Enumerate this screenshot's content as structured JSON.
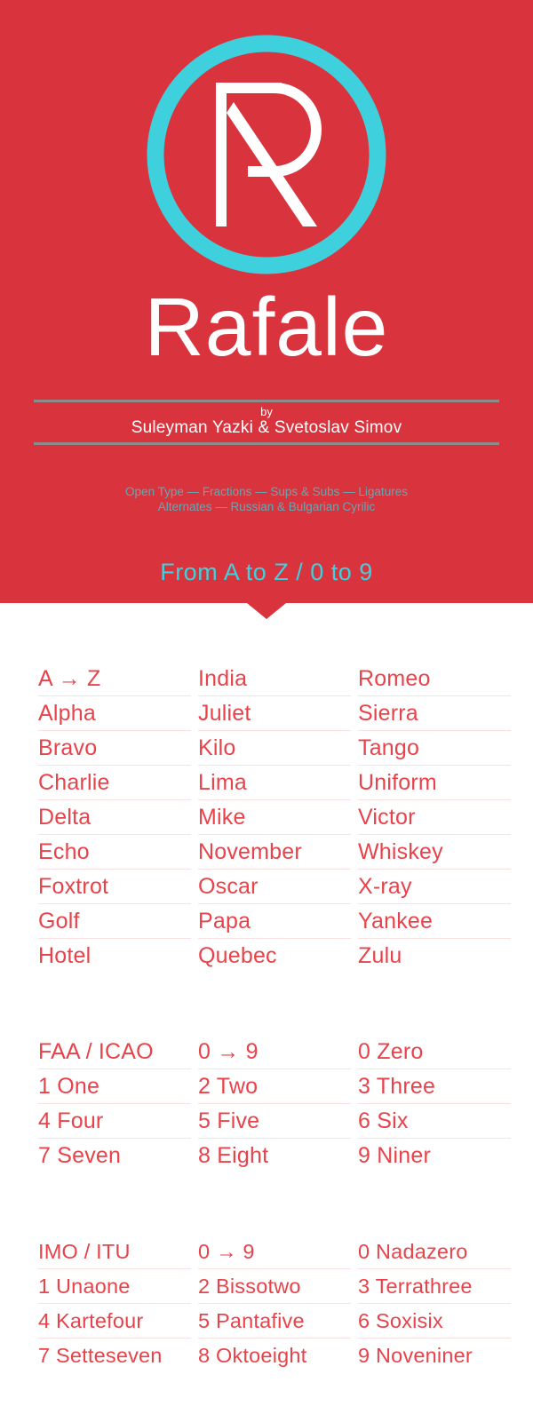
{
  "hero": {
    "logo_icon": "rafale-r-monogram-in-circle",
    "wordmark": "Rafale",
    "by_label": "by",
    "authors": "Suleyman Yazki & Svetoslav Simov",
    "features_line1": "Open Type — Fractions — Sups & Subs — Ligatures",
    "features_line2": "Alternates — Russian & Bulgarian Cyrilic",
    "tagline": "From A to Z / 0 to 9",
    "colors": {
      "background_red": "#d9343e",
      "accent_teal": "#3fd0dd",
      "features_teal": "#62a8b3",
      "rule_grey": "#8d8c8c",
      "wordmark_white": "#ffffff"
    }
  },
  "tables": {
    "alphabet": {
      "rows": [
        [
          "A → Z",
          "India",
          "Romeo"
        ],
        [
          "Alpha",
          "Juliet",
          "Sierra"
        ],
        [
          "Bravo",
          "Kilo",
          "Tango"
        ],
        [
          "Charlie",
          "Lima",
          "Uniform"
        ],
        [
          "Delta",
          "Mike",
          "Victor"
        ],
        [
          "Echo",
          "November",
          "Whiskey"
        ],
        [
          "Foxtrot",
          "Oscar",
          "X-ray"
        ],
        [
          "Golf",
          "Papa",
          "Yankee"
        ],
        [
          "Hotel",
          "Quebec",
          "Zulu"
        ]
      ]
    },
    "faa_icao": {
      "rows": [
        [
          "FAA / ICAO",
          "0 → 9",
          "0 Zero"
        ],
        [
          "1  One",
          "2 Two",
          "3 Three"
        ],
        [
          "4 Four",
          "5 Five",
          "6 Six"
        ],
        [
          "7 Seven",
          "8 Eight",
          "9 Niner"
        ]
      ]
    },
    "imo_itu": {
      "rows": [
        [
          "IMO / ITU",
          "0 → 9",
          "0 Nadazero"
        ],
        [
          "1  Unaone",
          "2 Bissotwo",
          "3 Terrathree"
        ],
        [
          "4 Kartefour",
          "5 Pantafive",
          "6 Soxisix"
        ],
        [
          "7 Setteseven",
          "8 Oktoeight",
          "9 Noveniner"
        ]
      ]
    },
    "colors": {
      "text_red": "#e8434b",
      "row_rule": "#fbe0e1"
    }
  }
}
